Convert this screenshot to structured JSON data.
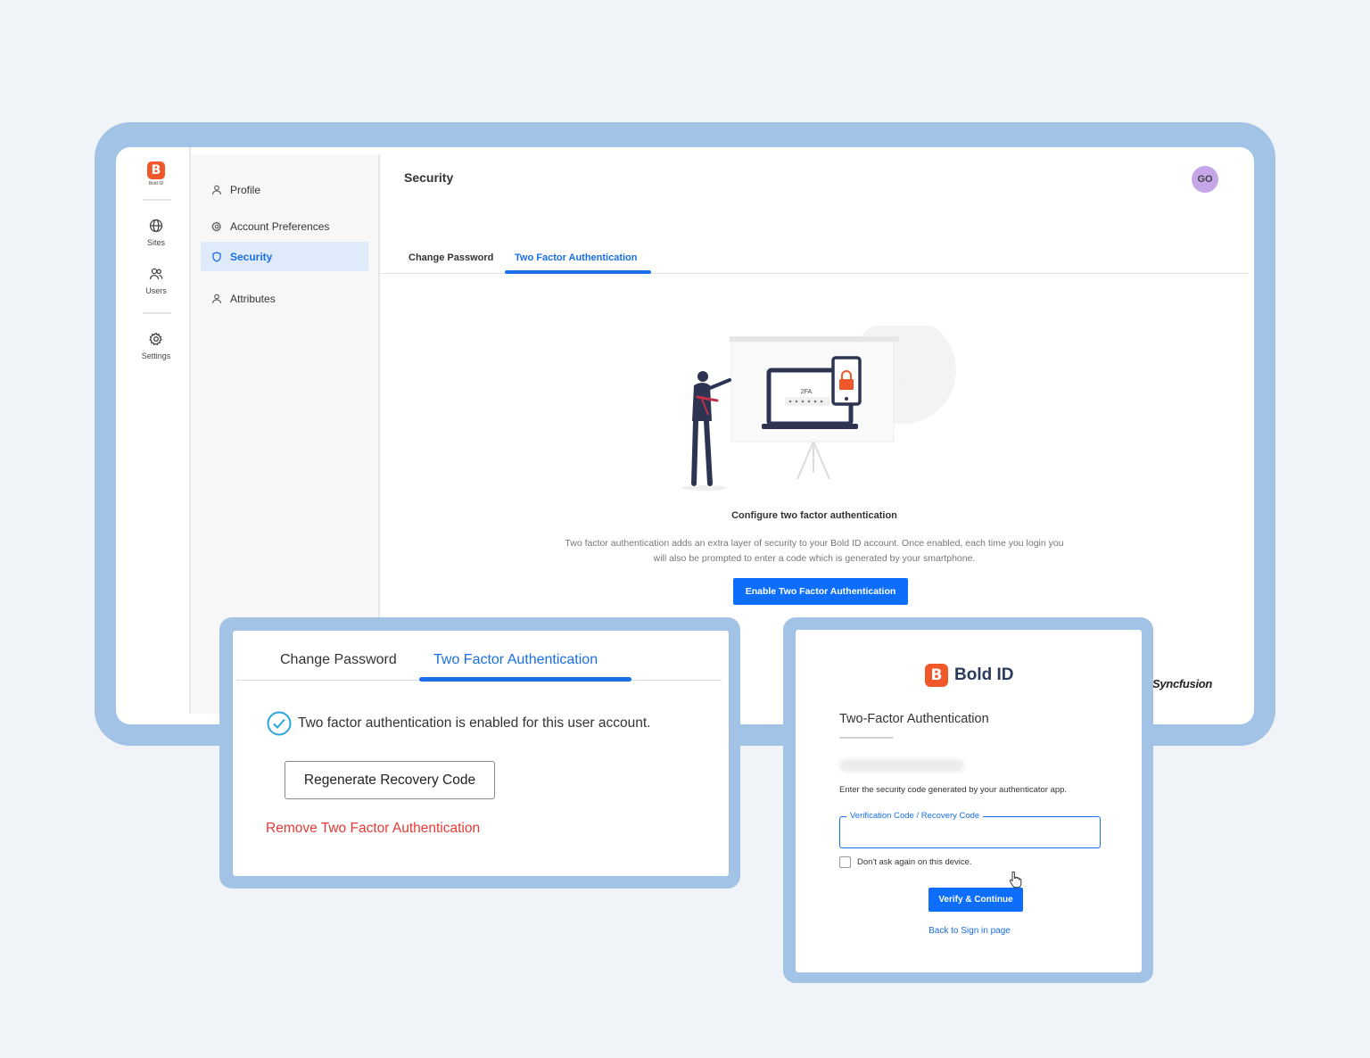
{
  "app": {
    "logo_letter": "B",
    "logo_caption": "Bold ID",
    "brand_color": "#f0582b",
    "accent_color": "#1a6ee8"
  },
  "rail": {
    "items": [
      {
        "label": "Sites",
        "icon": "globe-icon"
      },
      {
        "label": "Users",
        "icon": "users-icon"
      },
      {
        "label": "Settings",
        "icon": "gear-icon"
      }
    ]
  },
  "subnav": {
    "items": [
      {
        "label": "Profile",
        "icon": "user-icon"
      },
      {
        "label": "Account Preferences",
        "icon": "gear-icon"
      },
      {
        "label": "Security",
        "icon": "shield-icon",
        "active": true
      },
      {
        "label": "Attributes",
        "icon": "user-icon"
      }
    ]
  },
  "header": {
    "title": "Security",
    "avatar_initials": "GO"
  },
  "tabs": {
    "change_password": "Change Password",
    "two_factor": "Two Factor Authentication"
  },
  "setup": {
    "illustration_label": "2FA",
    "title": "Configure two factor authentication",
    "description_line1": "Two factor authentication adds an extra layer of security to your Bold ID account. Once enabled, each time you login you",
    "description_line2": "will also be prompted to enter a code which is generated by your smartphone.",
    "enable_button": "Enable Two Factor Authentication"
  },
  "watermark": "Syncfusion",
  "enabled_panel": {
    "tab_change_password": "Change Password",
    "tab_two_factor": "Two Factor Authentication",
    "status": "Two factor authentication is enabled for this user account.",
    "regenerate_button": "Regenerate Recovery Code",
    "remove_link": "Remove Two Factor Authentication"
  },
  "verify_panel": {
    "brand": "Bold ID",
    "title": "Two-Factor Authentication",
    "instruction": "Enter the security code generated by your authenticator app.",
    "field_label": "Verification Code / Recovery Code",
    "field_value": "",
    "remember_label": "Don't ask again on this device.",
    "remember_checked": false,
    "verify_button": "Verify & Continue",
    "back_link": "Back to Sign in page"
  }
}
